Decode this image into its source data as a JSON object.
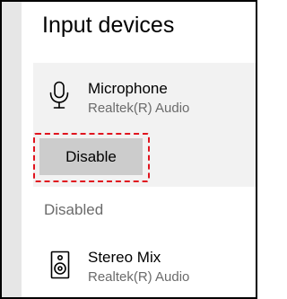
{
  "section": {
    "title": "Input devices"
  },
  "devices": {
    "active": {
      "name": "Microphone",
      "driver": "Realtek(R) Audio",
      "icon": "microphone-icon",
      "action_label": "Disable"
    }
  },
  "disabled_group": {
    "label": "Disabled",
    "items": [
      {
        "name": "Stereo Mix",
        "driver": "Realtek(R) Audio",
        "icon": "speaker-icon"
      }
    ]
  },
  "colors": {
    "highlight": "#e0141e",
    "button_bg": "#cccccc",
    "panel_bg": "#f2f2f2",
    "secondary_text": "#6b6b6b"
  }
}
